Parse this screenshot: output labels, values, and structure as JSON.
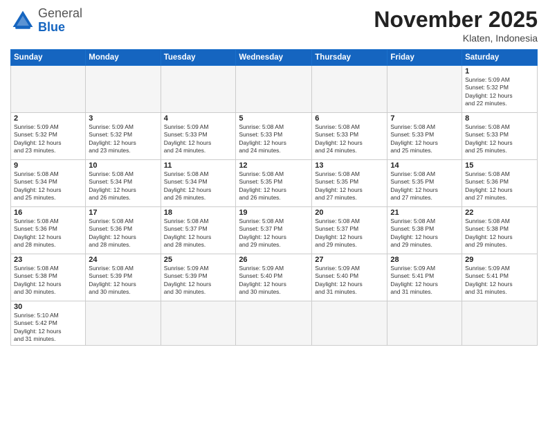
{
  "logo": {
    "general": "General",
    "blue": "Blue"
  },
  "header": {
    "month": "November 2025",
    "location": "Klaten, Indonesia"
  },
  "weekdays": [
    "Sunday",
    "Monday",
    "Tuesday",
    "Wednesday",
    "Thursday",
    "Friday",
    "Saturday"
  ],
  "days": [
    {
      "date": "",
      "info": ""
    },
    {
      "date": "",
      "info": ""
    },
    {
      "date": "",
      "info": ""
    },
    {
      "date": "",
      "info": ""
    },
    {
      "date": "",
      "info": ""
    },
    {
      "date": "",
      "info": ""
    },
    {
      "date": "1",
      "info": "Sunrise: 5:09 AM\nSunset: 5:32 PM\nDaylight: 12 hours\nand 22 minutes."
    },
    {
      "date": "2",
      "info": "Sunrise: 5:09 AM\nSunset: 5:32 PM\nDaylight: 12 hours\nand 23 minutes."
    },
    {
      "date": "3",
      "info": "Sunrise: 5:09 AM\nSunset: 5:32 PM\nDaylight: 12 hours\nand 23 minutes."
    },
    {
      "date": "4",
      "info": "Sunrise: 5:09 AM\nSunset: 5:33 PM\nDaylight: 12 hours\nand 24 minutes."
    },
    {
      "date": "5",
      "info": "Sunrise: 5:08 AM\nSunset: 5:33 PM\nDaylight: 12 hours\nand 24 minutes."
    },
    {
      "date": "6",
      "info": "Sunrise: 5:08 AM\nSunset: 5:33 PM\nDaylight: 12 hours\nand 24 minutes."
    },
    {
      "date": "7",
      "info": "Sunrise: 5:08 AM\nSunset: 5:33 PM\nDaylight: 12 hours\nand 25 minutes."
    },
    {
      "date": "8",
      "info": "Sunrise: 5:08 AM\nSunset: 5:33 PM\nDaylight: 12 hours\nand 25 minutes."
    },
    {
      "date": "9",
      "info": "Sunrise: 5:08 AM\nSunset: 5:34 PM\nDaylight: 12 hours\nand 25 minutes."
    },
    {
      "date": "10",
      "info": "Sunrise: 5:08 AM\nSunset: 5:34 PM\nDaylight: 12 hours\nand 26 minutes."
    },
    {
      "date": "11",
      "info": "Sunrise: 5:08 AM\nSunset: 5:34 PM\nDaylight: 12 hours\nand 26 minutes."
    },
    {
      "date": "12",
      "info": "Sunrise: 5:08 AM\nSunset: 5:35 PM\nDaylight: 12 hours\nand 26 minutes."
    },
    {
      "date": "13",
      "info": "Sunrise: 5:08 AM\nSunset: 5:35 PM\nDaylight: 12 hours\nand 27 minutes."
    },
    {
      "date": "14",
      "info": "Sunrise: 5:08 AM\nSunset: 5:35 PM\nDaylight: 12 hours\nand 27 minutes."
    },
    {
      "date": "15",
      "info": "Sunrise: 5:08 AM\nSunset: 5:36 PM\nDaylight: 12 hours\nand 27 minutes."
    },
    {
      "date": "16",
      "info": "Sunrise: 5:08 AM\nSunset: 5:36 PM\nDaylight: 12 hours\nand 28 minutes."
    },
    {
      "date": "17",
      "info": "Sunrise: 5:08 AM\nSunset: 5:36 PM\nDaylight: 12 hours\nand 28 minutes."
    },
    {
      "date": "18",
      "info": "Sunrise: 5:08 AM\nSunset: 5:37 PM\nDaylight: 12 hours\nand 28 minutes."
    },
    {
      "date": "19",
      "info": "Sunrise: 5:08 AM\nSunset: 5:37 PM\nDaylight: 12 hours\nand 29 minutes."
    },
    {
      "date": "20",
      "info": "Sunrise: 5:08 AM\nSunset: 5:37 PM\nDaylight: 12 hours\nand 29 minutes."
    },
    {
      "date": "21",
      "info": "Sunrise: 5:08 AM\nSunset: 5:38 PM\nDaylight: 12 hours\nand 29 minutes."
    },
    {
      "date": "22",
      "info": "Sunrise: 5:08 AM\nSunset: 5:38 PM\nDaylight: 12 hours\nand 29 minutes."
    },
    {
      "date": "23",
      "info": "Sunrise: 5:08 AM\nSunset: 5:38 PM\nDaylight: 12 hours\nand 30 minutes."
    },
    {
      "date": "24",
      "info": "Sunrise: 5:08 AM\nSunset: 5:39 PM\nDaylight: 12 hours\nand 30 minutes."
    },
    {
      "date": "25",
      "info": "Sunrise: 5:09 AM\nSunset: 5:39 PM\nDaylight: 12 hours\nand 30 minutes."
    },
    {
      "date": "26",
      "info": "Sunrise: 5:09 AM\nSunset: 5:40 PM\nDaylight: 12 hours\nand 30 minutes."
    },
    {
      "date": "27",
      "info": "Sunrise: 5:09 AM\nSunset: 5:40 PM\nDaylight: 12 hours\nand 31 minutes."
    },
    {
      "date": "28",
      "info": "Sunrise: 5:09 AM\nSunset: 5:41 PM\nDaylight: 12 hours\nand 31 minutes."
    },
    {
      "date": "29",
      "info": "Sunrise: 5:09 AM\nSunset: 5:41 PM\nDaylight: 12 hours\nand 31 minutes."
    },
    {
      "date": "30",
      "info": "Sunrise: 5:10 AM\nSunset: 5:42 PM\nDaylight: 12 hours\nand 31 minutes."
    },
    {
      "date": "",
      "info": ""
    },
    {
      "date": "",
      "info": ""
    },
    {
      "date": "",
      "info": ""
    },
    {
      "date": "",
      "info": ""
    },
    {
      "date": "",
      "info": ""
    },
    {
      "date": "",
      "info": ""
    }
  ]
}
